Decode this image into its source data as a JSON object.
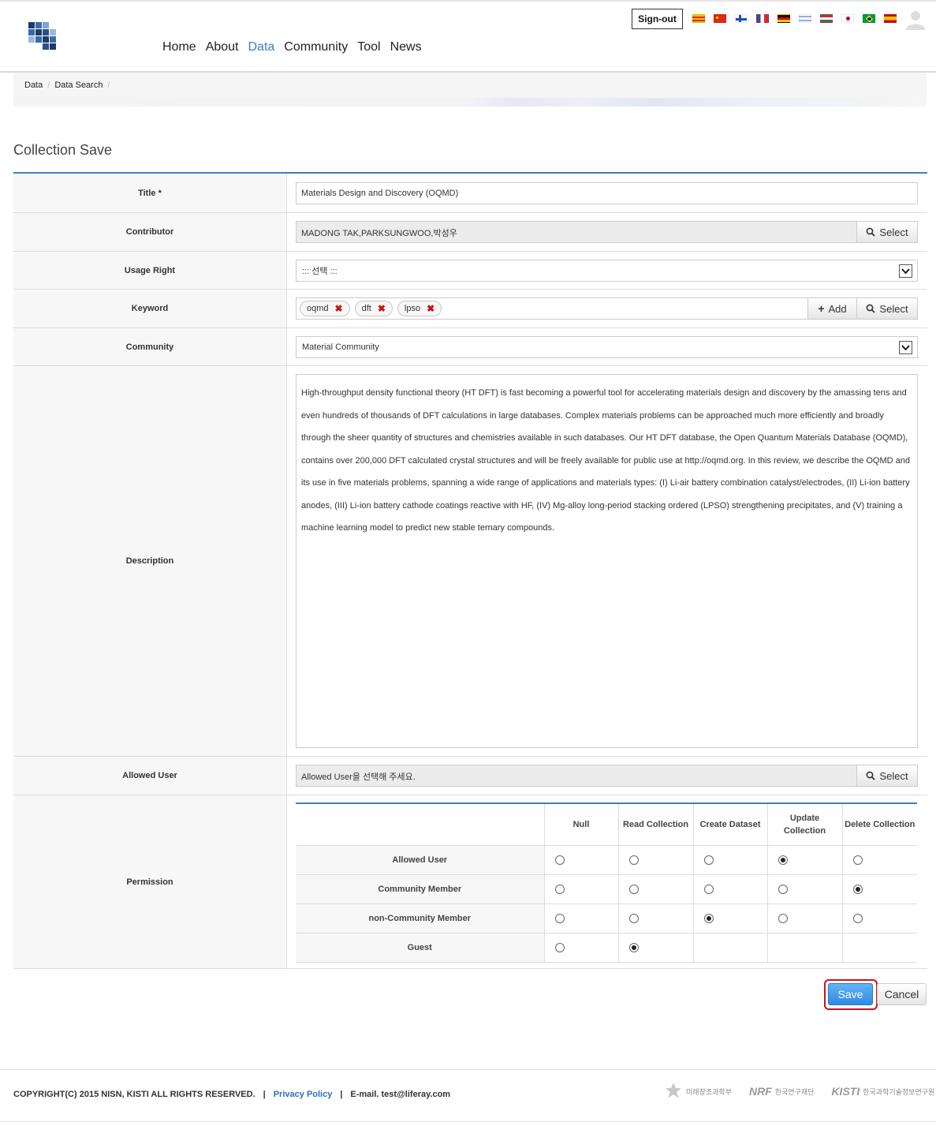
{
  "header": {
    "signout_label": "Sign-out",
    "nav": [
      {
        "label": "Home",
        "active": false
      },
      {
        "label": "About",
        "active": false
      },
      {
        "label": "Data",
        "active": true
      },
      {
        "label": "Community",
        "active": false
      },
      {
        "label": "Tool",
        "active": false
      },
      {
        "label": "News",
        "active": false
      }
    ],
    "languages": [
      "catalan",
      "chinese",
      "finnish",
      "french",
      "german",
      "hebrew",
      "hungarian",
      "japanese",
      "portuguese-brazil",
      "spanish"
    ]
  },
  "breadcrumb": [
    "Data",
    "Data Search"
  ],
  "page_title": "Collection Save",
  "form": {
    "title_label": "Title *",
    "title_value": "Materials Design and Discovery (OQMD)",
    "contributor_label": "Contributor",
    "contributor_value": "MADONG TAK,PARKSUNGWOO,박성우",
    "select_label": "Select",
    "usage_label": "Usage Right",
    "usage_value": "::: 선택 :::",
    "keyword_label": "Keyword",
    "keywords": [
      "oqmd",
      "dft",
      "lpso"
    ],
    "add_label": "Add",
    "community_label": "Community",
    "community_value": "Material Community",
    "description_label": "Description",
    "description_value": "High-throughput density functional theory (HT DFT) is fast becoming a powerful tool for accelerating materials design and discovery by the amassing tens and even hundreds of thousands of DFT calculations in large databases. Complex materials problems can be approached much more efficiently and broadly through the sheer quantity of structures and chemistries available in such databases. Our HT DFT database, the Open Quantum Materials Database (OQMD), contains over 200,000 DFT calculated crystal structures and will be freely available for public use at http://oqmd.org. In this review, we describe the OQMD and its use in five materials problems, spanning a wide range of applications and materials types: (I) Li-air battery combination catalyst/electrodes, (II) Li-ion battery anodes, (III) Li-ion battery cathode coatings reactive with HF, (IV) Mg-alloy long-period stacking ordered (LPSO) strengthening precipitates, and (V) training a machine learning model to predict new stable ternary compounds.",
    "allowed_user_label": "Allowed User",
    "allowed_user_value": "Allowed User을 선택해 주세요.",
    "permission_label": "Permission"
  },
  "permission": {
    "columns": [
      "Null",
      "Read Collection",
      "Create Dataset",
      "Update Collection",
      "Delete Collection"
    ],
    "rows": [
      {
        "label": "Allowed User",
        "selected": 3,
        "options": 5
      },
      {
        "label": "Community Member",
        "selected": 4,
        "options": 5
      },
      {
        "label": "non-Community Member",
        "selected": 2,
        "options": 5
      },
      {
        "label": "Guest",
        "selected": 1,
        "options": 2
      }
    ]
  },
  "actions": {
    "save_label": "Save",
    "cancel_label": "Cancel"
  },
  "footer": {
    "copyright": "COPYRIGHT(C) 2015 NISN, KISTI ALL RIGHTS RESERVED.",
    "privacy_label": "Privacy Policy",
    "email": "E-mail. test@liferay.com",
    "partners": [
      {
        "mark": "",
        "name": "미래창조과학부"
      },
      {
        "mark": "NRF",
        "name": "한국연구재단"
      },
      {
        "mark": "KISTI",
        "name": "한국과학기술정보연구원"
      }
    ]
  },
  "colors": {
    "accent": "#3f7fba",
    "nav_active": "#3b7dc4",
    "save_button": "#2e8ae6",
    "highlight_ring": "#d0101c"
  }
}
